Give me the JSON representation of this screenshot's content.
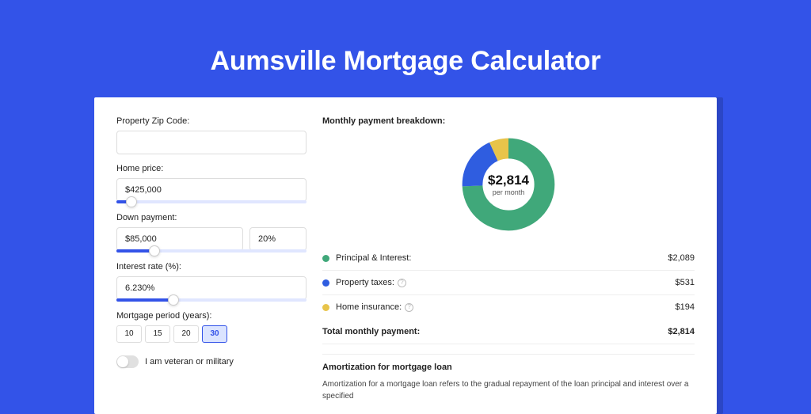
{
  "page_title": "Aumsville Mortgage Calculator",
  "form": {
    "zip_label": "Property Zip Code:",
    "zip_value": "",
    "home_price_label": "Home price:",
    "home_price_value": "$425,000",
    "home_price_fill_pct": 8,
    "down_payment_label": "Down payment:",
    "down_payment_value": "$85,000",
    "down_payment_pct_value": "20%",
    "down_payment_fill_pct": 20,
    "interest_label": "Interest rate (%):",
    "interest_value": "6.230%",
    "interest_fill_pct": 30,
    "period_label": "Mortgage period (years):",
    "period_options": [
      "10",
      "15",
      "20",
      "30"
    ],
    "period_selected": "30",
    "veteran_label": "I am veteran or military"
  },
  "breakdown": {
    "title": "Monthly payment breakdown:",
    "center_amount": "$2,814",
    "center_sub": "per month",
    "rows": [
      {
        "color": "green",
        "label": "Principal & Interest:",
        "value": "$2,089",
        "info": false
      },
      {
        "color": "blue",
        "label": "Property taxes:",
        "value": "$531",
        "info": true
      },
      {
        "color": "yellow",
        "label": "Home insurance:",
        "value": "$194",
        "info": true
      }
    ],
    "total_label": "Total monthly payment:",
    "total_value": "$2,814"
  },
  "amortization": {
    "title": "Amortization for mortgage loan",
    "text": "Amortization for a mortgage loan refers to the gradual repayment of the loan principal and interest over a specified"
  },
  "chart_data": {
    "type": "pie",
    "title": "Monthly payment breakdown",
    "series": [
      {
        "name": "Principal & Interest",
        "value": 2089,
        "color": "#40a87a"
      },
      {
        "name": "Property taxes",
        "value": 531,
        "color": "#2f5de0"
      },
      {
        "name": "Home insurance",
        "value": 194,
        "color": "#e8c44a"
      }
    ],
    "total": 2814,
    "center_label": "$2,814 per month"
  }
}
